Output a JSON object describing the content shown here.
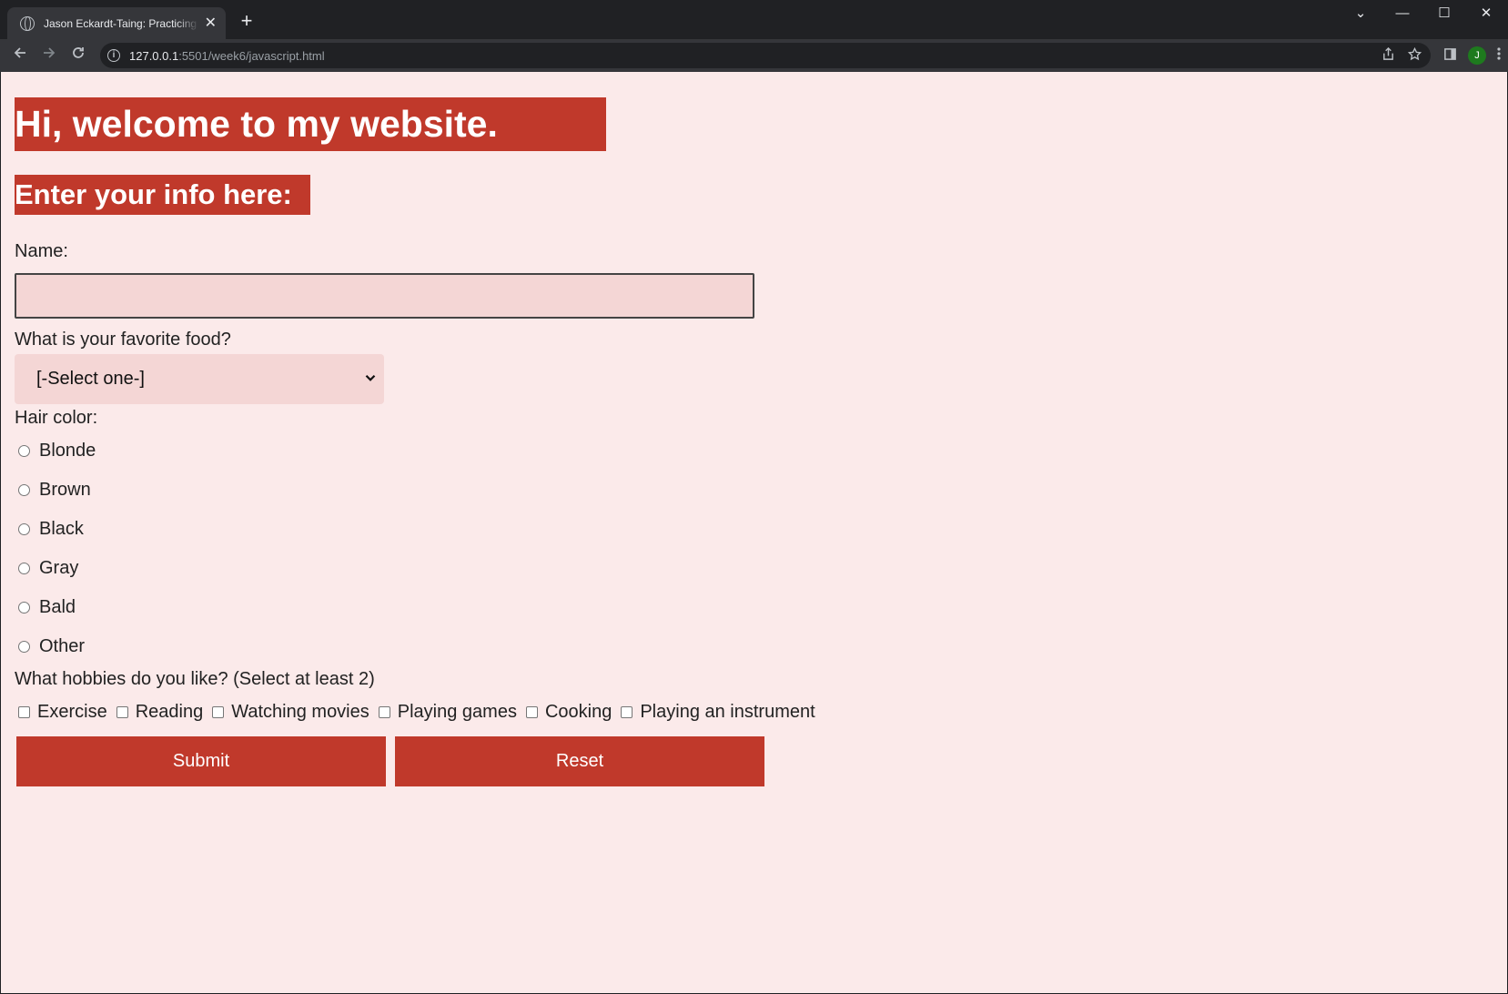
{
  "browser": {
    "tab_title": "Jason Eckardt-Taing: Practicing using JavaScript",
    "tab_close": "✕",
    "new_tab": "+",
    "url_host": "127.0.0.1",
    "url_path": ":5501/week6/javascript.html",
    "profile_initial": "J",
    "icons": [
      "globe-icon",
      "back-icon",
      "forward-icon",
      "reload-icon",
      "info-icon",
      "share-icon",
      "star-icon",
      "sidepanel-icon",
      "menu-icon"
    ]
  },
  "window_controls": {
    "tabsearch": "⌄",
    "minimize": "—",
    "maximize": "☐",
    "close": "✕"
  },
  "page": {
    "heading": "Hi, welcome to my website.",
    "subheading": "Enter your info here:",
    "name_label": "Name:",
    "name_value": "",
    "food_label": "What is your favorite food?",
    "food_selected": "[-Select one-]",
    "hair_label": "Hair color:",
    "hair_options": [
      "Blonde",
      "Brown",
      "Black",
      "Gray",
      "Bald",
      "Other"
    ],
    "hobbies_label": "What hobbies do you like? (Select at least 2)",
    "hobbies": [
      "Exercise",
      "Reading",
      "Watching movies",
      "Playing games",
      "Cooking",
      "Playing an instrument"
    ],
    "submit_label": "Submit",
    "reset_label": "Reset"
  },
  "colors": {
    "accent": "#c0392b",
    "page_bg": "#fbeaea",
    "input_bg": "#f4d6d5"
  }
}
